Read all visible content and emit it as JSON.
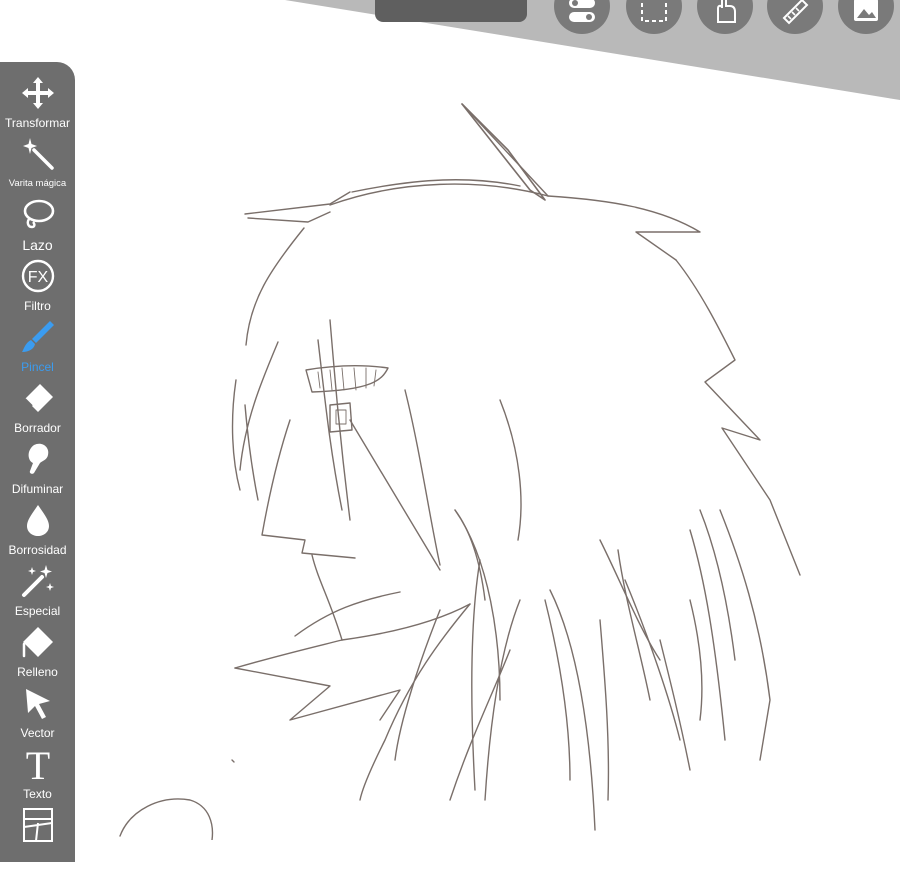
{
  "app": {
    "accent": "#3b9cf0",
    "toolbar_color": "#6e6e6e",
    "banner_color": "#b9b9b9"
  },
  "top_actions": [
    {
      "icon": "toggle-settings-icon"
    },
    {
      "icon": "selection-icon"
    },
    {
      "icon": "hand-gesture-icon"
    },
    {
      "icon": "ruler-icon"
    },
    {
      "icon": "layers-image-icon"
    }
  ],
  "tools": {
    "transform": {
      "label": "Transformar",
      "icon": "move-arrows-icon"
    },
    "magic_wand": {
      "label": "Varita mágica",
      "icon": "magic-wand-icon"
    },
    "lasso": {
      "label": "Lazo",
      "icon": "lasso-icon"
    },
    "filter": {
      "label": "Filtro",
      "icon": "fx-icon",
      "glyph": "FX"
    },
    "brush": {
      "label": "Pincel",
      "icon": "brush-icon",
      "active": true
    },
    "eraser": {
      "label": "Borrador",
      "icon": "eraser-icon"
    },
    "blur": {
      "label": "Difuminar",
      "icon": "smudge-finger-icon"
    },
    "blur_drop": {
      "label": "Borrosidad",
      "icon": "blur-drop-icon"
    },
    "special": {
      "label": "Especial",
      "icon": "special-brush-icon"
    },
    "fill": {
      "label": "Relleno",
      "icon": "paint-bucket-icon"
    },
    "vector": {
      "label": "Vector",
      "icon": "vector-cursor-icon"
    },
    "text": {
      "label": "Texto",
      "icon": "text-icon",
      "glyph": "T"
    },
    "frame": {
      "label": "",
      "icon": "frame-divider-icon"
    }
  }
}
